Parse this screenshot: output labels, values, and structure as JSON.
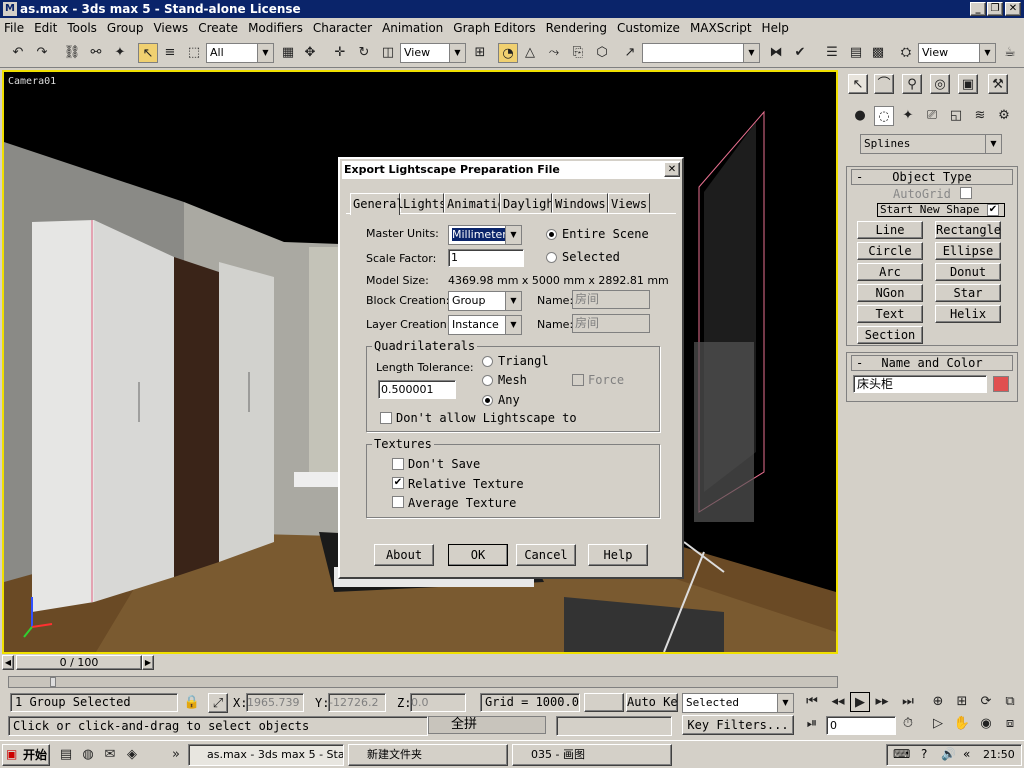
{
  "window": {
    "title": "as.max - 3ds max 5 - Stand-alone License"
  },
  "menu": [
    "File",
    "Edit",
    "Tools",
    "Group",
    "Views",
    "Create",
    "Modifiers",
    "Character",
    "Animation",
    "Graph Editors",
    "Rendering",
    "Customize",
    "MAXScript",
    "Help"
  ],
  "toolbar": {
    "selection_filter": "All",
    "ref_coord": "View",
    "named_sel": "",
    "view_combo": "View"
  },
  "viewport": {
    "label": "Camera01"
  },
  "command_panel": {
    "category": "Splines",
    "object_type_title": "Object Type",
    "autogrid": "AutoGrid",
    "start_new_shape": "Start New Shape",
    "buttons": [
      "Line",
      "Rectangle",
      "Circle",
      "Ellipse",
      "Arc",
      "Donut",
      "NGon",
      "Star",
      "Text",
      "Helix",
      "Section"
    ],
    "name_color_title": "Name and Color",
    "object_name": "床头柜",
    "object_color": "#e05050"
  },
  "dialog": {
    "title": "Export Lightscape Preparation File",
    "tabs": [
      "General",
      "Lights",
      "Animation",
      "Daylight",
      "Windows",
      "Views"
    ],
    "master_units_label": "Master Units:",
    "master_units_value": "Millimeters",
    "entire_scene": "Entire Scene",
    "selected": "Selected",
    "scale_factor_label": "Scale Factor:",
    "scale_factor_value": "1",
    "model_size_label": "Model Size:",
    "model_size_value": "4369.98 mm x 5000 mm x 2892.81 mm",
    "block_creation_label": "Block Creation:",
    "block_creation_value": "Group",
    "layer_creation_label": "Layer Creation:",
    "layer_creation_value": "Instance",
    "name_label": "Name:",
    "block_name": "房间",
    "layer_name": "房间",
    "quad_title": "Quadrilaterals",
    "length_tolerance_label": "Length Tolerance:",
    "length_tolerance_value": "0.500001",
    "triangle": "Triangl",
    "mesh": "Mesh",
    "any": "Any",
    "force": "Force",
    "dont_allow": "Don't allow Lightscape to",
    "textures_title": "Textures",
    "dont_save": "Don't Save",
    "relative_texture": "Relative Texture",
    "average_texture": "Average Texture",
    "btn_about": "About",
    "btn_ok": "OK",
    "btn_cancel": "Cancel",
    "btn_help": "Help"
  },
  "timeline": {
    "frame": "0 / 100"
  },
  "status": {
    "selection": "1 Group Selected",
    "prompt": "Click or click-and-drag to select objects",
    "x_label": "X:",
    "x_value": "1965.739",
    "y_label": "Y:",
    "y_value": "-12726.2",
    "z_label": "Z:",
    "z_value": "0.0",
    "grid": "Grid = 1000.0",
    "auto_key": "Auto Key",
    "key_mode": "Selected",
    "key_filters": "Key Filters...",
    "frame_field": "0",
    "ime": "全拼"
  },
  "taskbar": {
    "start": "开始",
    "tasks": [
      "as.max - 3ds max 5 - Sta...",
      "新建文件夹",
      "035 - 画图"
    ],
    "clock": "21:50"
  }
}
